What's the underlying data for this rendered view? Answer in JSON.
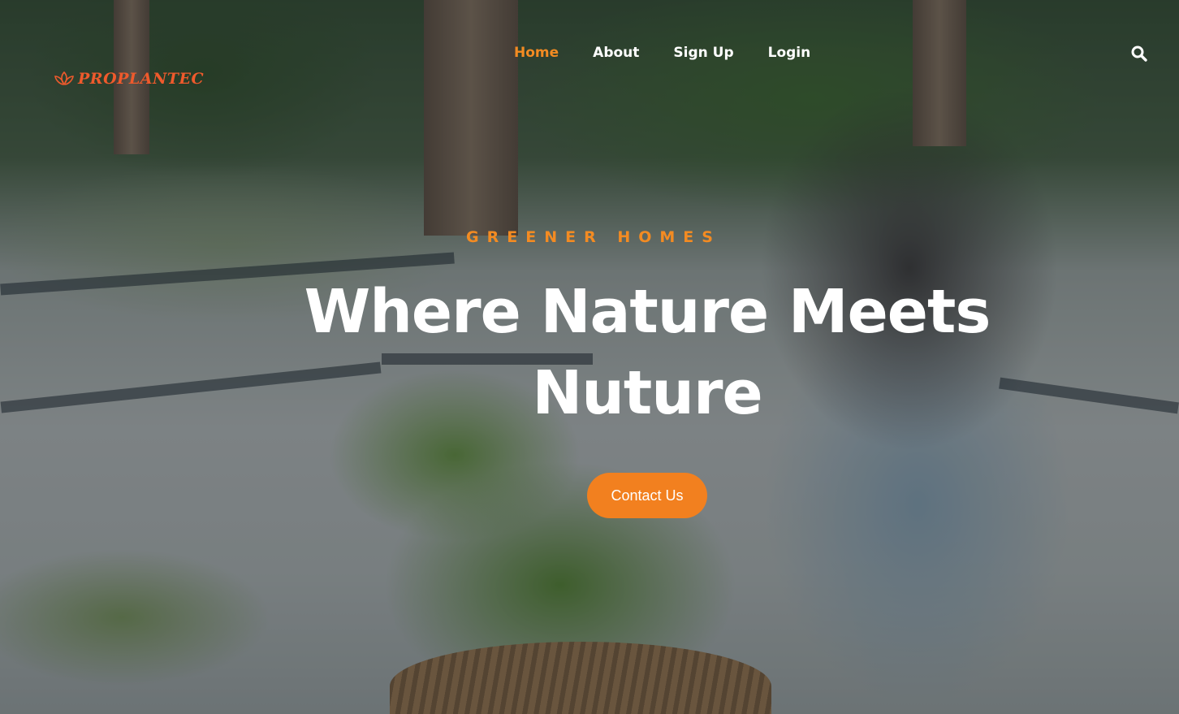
{
  "brand": {
    "name": "PROPLANTEC",
    "logo_icon": "lotus-leaf-icon",
    "accent_color": "#f38b22",
    "logo_color": "#ef5a2c"
  },
  "nav": {
    "items": [
      {
        "label": "Home",
        "active": true
      },
      {
        "label": "About",
        "active": false
      },
      {
        "label": "Sign Up",
        "active": false
      },
      {
        "label": "Login",
        "active": false
      }
    ],
    "search_icon": "search-icon"
  },
  "hero": {
    "eyebrow": "GREENER HOMES",
    "headline": "Where Nature Meets Nuture",
    "cta_label": "Contact Us",
    "cta_color": "#f2801f"
  }
}
